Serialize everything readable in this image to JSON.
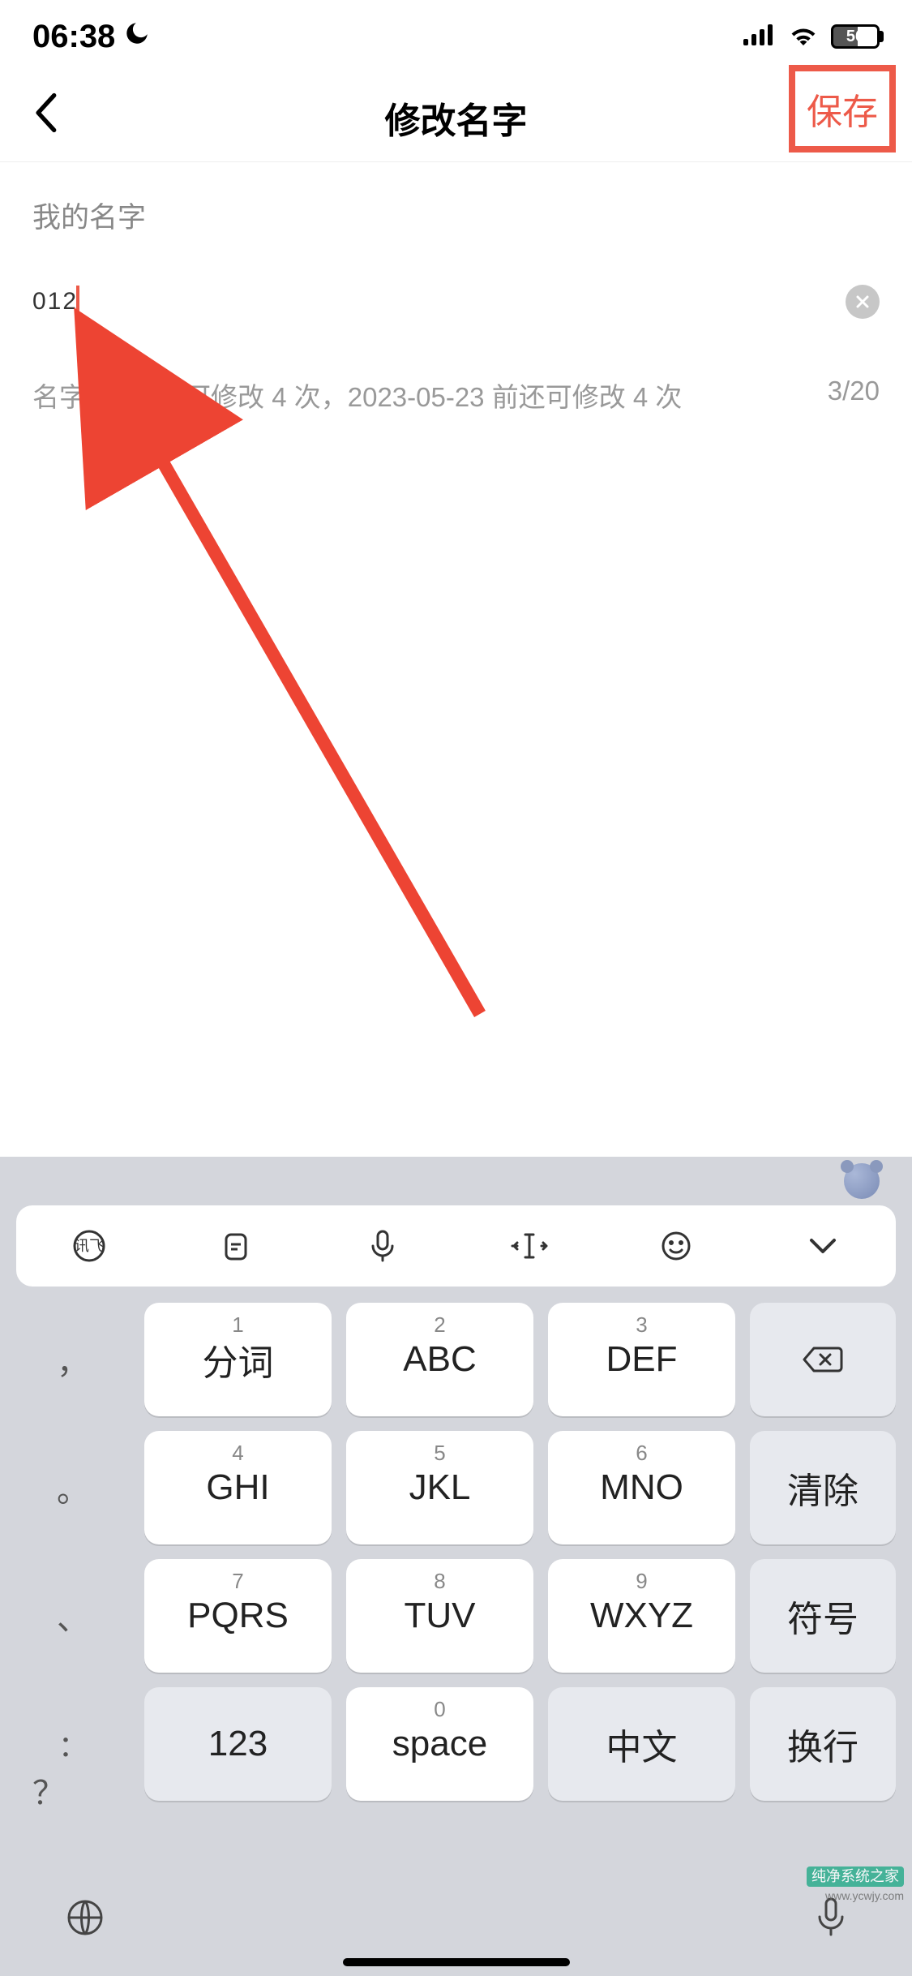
{
  "status": {
    "time": "06:38",
    "moon_icon": "moon-icon",
    "battery": "56"
  },
  "nav": {
    "title": "修改名字",
    "save": "保存"
  },
  "form": {
    "section_label": "我的名字",
    "input_value": "012",
    "hint": "名字 30 天内可修改 4 次，2023-05-23 前还可修改 4 次",
    "counter": "3/20"
  },
  "keyboard": {
    "toolbar": [
      "xunfei-icon",
      "clipboard-icon",
      "mic-icon",
      "cursor-move-icon",
      "emoji-icon",
      "chevron-down-icon"
    ],
    "left_col": [
      "，",
      "。",
      "、",
      "：",
      "？"
    ],
    "keys": [
      {
        "num": "1",
        "label": "分词"
      },
      {
        "num": "2",
        "label": "ABC"
      },
      {
        "num": "3",
        "label": "DEF"
      },
      {
        "num": "4",
        "label": "GHI"
      },
      {
        "num": "5",
        "label": "JKL"
      },
      {
        "num": "6",
        "label": "MNO"
      },
      {
        "num": "7",
        "label": "PQRS"
      },
      {
        "num": "8",
        "label": "TUV"
      },
      {
        "num": "9",
        "label": "WXYZ"
      }
    ],
    "right_col": [
      "backspace",
      "清除",
      "符号",
      "换行"
    ],
    "bottom_row": {
      "num123": "123",
      "space_num": "0",
      "space_label": "space",
      "lang": "中文"
    }
  },
  "watermark": {
    "brand": "纯净系统之家",
    "url": "www.ycwjy.com"
  },
  "colors": {
    "accent": "#ed5a49"
  }
}
